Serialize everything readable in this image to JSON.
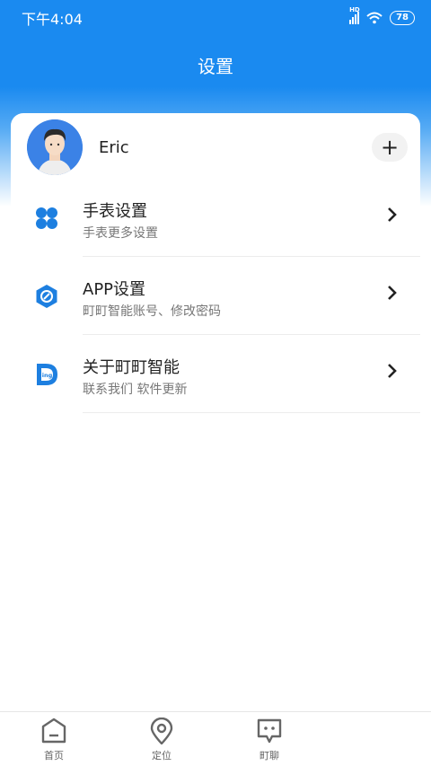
{
  "status_bar": {
    "time": "下午4:04",
    "network": "HD",
    "battery": "78"
  },
  "header": {
    "title": "设置"
  },
  "profile": {
    "name": "Eric",
    "add_label": "+"
  },
  "menu": [
    {
      "title": "手表设置",
      "subtitle": "手表更多设置",
      "icon": "clover-icon"
    },
    {
      "title": "APP设置",
      "subtitle": "町町智能账号、修改密码",
      "icon": "hexagon-compass-icon"
    },
    {
      "title": "关于町町智能",
      "subtitle": "联系我们 软件更新",
      "icon": "ding-logo-icon"
    }
  ],
  "bottom_nav": [
    {
      "label": "首页",
      "icon": "home-icon"
    },
    {
      "label": "定位",
      "icon": "location-pin-icon"
    },
    {
      "label": "町聊",
      "icon": "chat-bubble-icon"
    }
  ],
  "colors": {
    "primary": "#1a8af0",
    "icon_blue": "#1d7fe0"
  }
}
